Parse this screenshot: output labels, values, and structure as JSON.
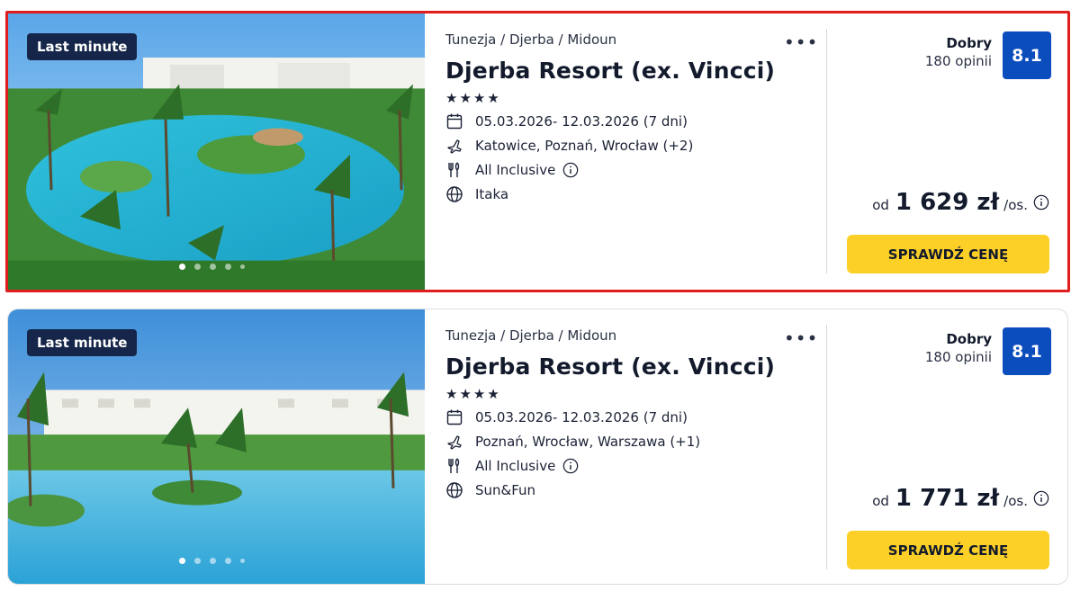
{
  "offers": [
    {
      "badge": "Last minute",
      "breadcrumb": "Tunezja / Djerba / Midoun",
      "more_label": "•••",
      "hotel_name": "Djerba Resort (ex. Vincci)",
      "stars": 4,
      "stars_text": "★★★★",
      "dates": "05.03.2026- 12.03.2026  (7 dni)",
      "departure": "Katowice, Poznań, Wrocław  (+2)",
      "board": "All Inclusive",
      "operator": "Itaka",
      "rating_label": "Dobry",
      "reviews": "180 opinii",
      "score": "8.1",
      "price_prefix": "od",
      "price": "1 629 zł",
      "price_suffix": "/os.",
      "cta": "SPRAWDŹ CENĘ",
      "selected": true
    },
    {
      "badge": "Last minute",
      "breadcrumb": "Tunezja / Djerba / Midoun",
      "more_label": "•••",
      "hotel_name": "Djerba Resort (ex. Vincci)",
      "stars": 4,
      "stars_text": "★★★★",
      "dates": "05.03.2026- 12.03.2026  (7 dni)",
      "departure": "Poznań, Wrocław, Warszawa  (+1)",
      "board": "All Inclusive",
      "operator": "Sun&Fun",
      "rating_label": "Dobry",
      "reviews": "180 opinii",
      "score": "8.1",
      "price_prefix": "od",
      "price": "1 771 zł",
      "price_suffix": "/os.",
      "cta": "SPRAWDŹ CENĘ",
      "selected": false
    }
  ],
  "colors": {
    "badge_bg": "#15264a",
    "score_bg": "#0b4dbd",
    "cta_bg": "#fdd027",
    "selection_border": "#e01e1e"
  },
  "icons": [
    "heart-icon",
    "more-dots-icon",
    "calendar-icon",
    "plane-icon",
    "cutlery-icon",
    "info-icon",
    "globe-icon"
  ]
}
